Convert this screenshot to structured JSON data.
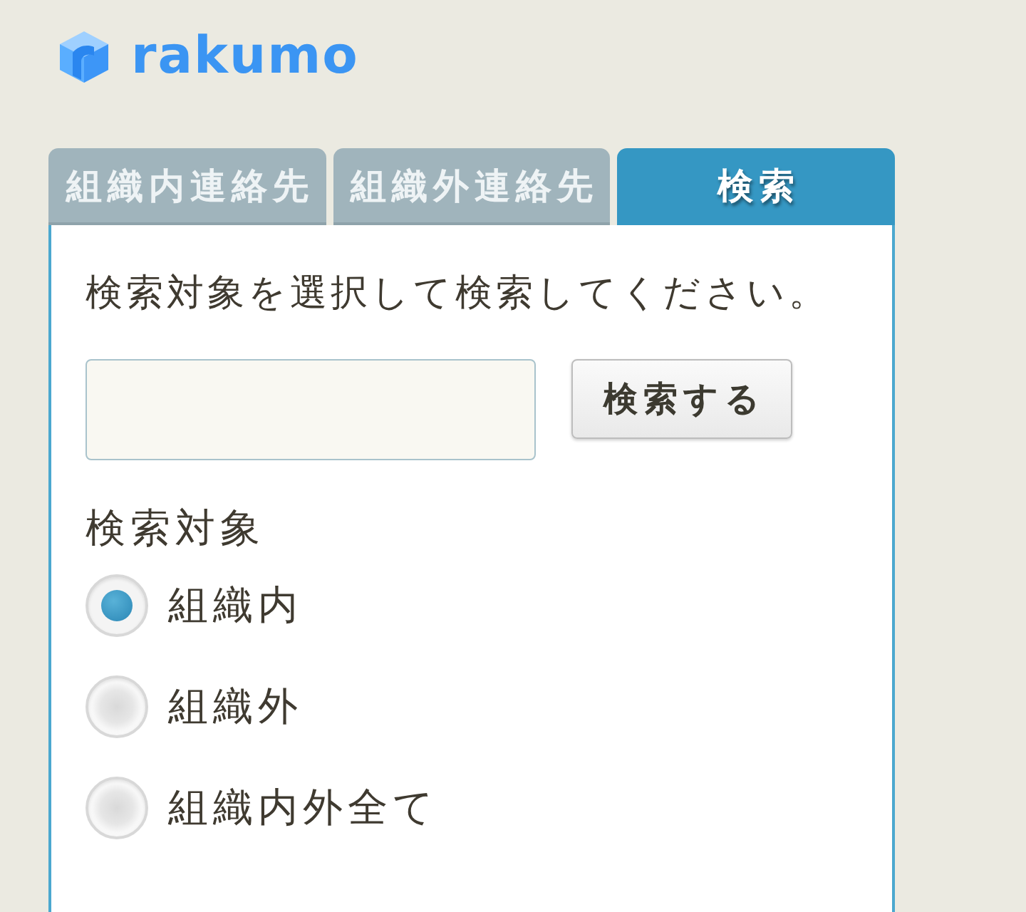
{
  "logo": {
    "text": "rakumo"
  },
  "tabs": [
    {
      "label": "組織内連絡先",
      "selected": false
    },
    {
      "label": "組織外連絡先",
      "selected": false
    },
    {
      "label": "検索",
      "selected": true
    }
  ],
  "search": {
    "instruction": "検索対象を選択して検索してください。",
    "button": "検索する"
  },
  "scope": {
    "label": "検索対象",
    "options": [
      {
        "label": "組織内",
        "selected": true
      },
      {
        "label": "組織外",
        "selected": false
      },
      {
        "label": "組織内外全て",
        "selected": false
      }
    ]
  }
}
